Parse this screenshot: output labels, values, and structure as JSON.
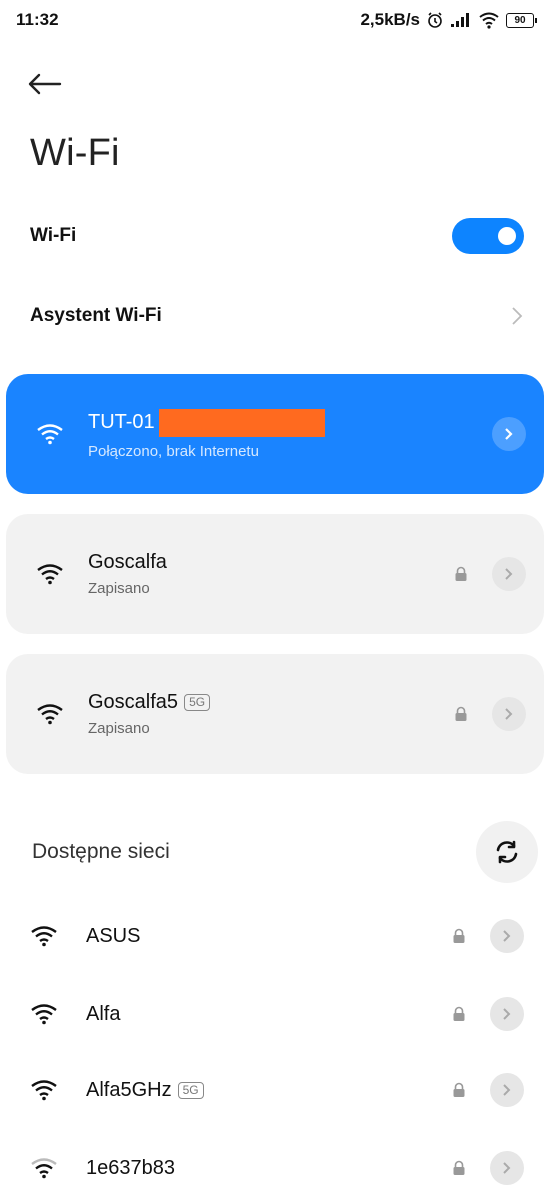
{
  "status_bar": {
    "time": "11:32",
    "speed": "2,5kB/s",
    "battery": "90"
  },
  "page": {
    "title": "Wi-Fi"
  },
  "settings": {
    "wifi_label": "Wi-Fi",
    "wifi_enabled": true,
    "assistant_label": "Asystent Wi-Fi"
  },
  "connected": {
    "name": "TUT-01",
    "status": "Połączono, brak Internetu"
  },
  "saved": [
    {
      "name": "Goscalfa",
      "status": "Zapisano",
      "badge": ""
    },
    {
      "name": "Goscalfa5",
      "status": "Zapisano",
      "badge": "5G"
    }
  ],
  "available": {
    "title": "Dostępne sieci",
    "networks": [
      {
        "name": "ASUS",
        "badge": ""
      },
      {
        "name": "Alfa",
        "badge": ""
      },
      {
        "name": "Alfa5GHz",
        "badge": "5G"
      },
      {
        "name": "1e637b83",
        "badge": ""
      }
    ]
  },
  "colors": {
    "accent": "#1a84ff",
    "redaction": "#ff6a1f"
  }
}
